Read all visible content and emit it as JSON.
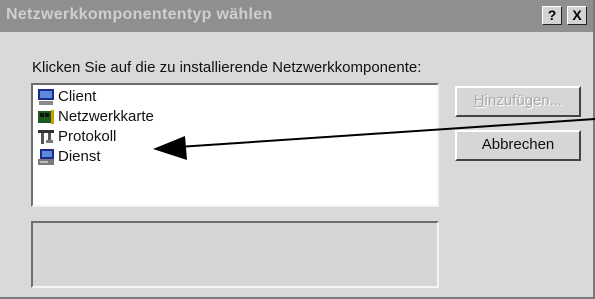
{
  "window": {
    "title": "Netzwerkkomponententyp wählen",
    "help_label": "?",
    "close_label": "X"
  },
  "prompt": "Klicken Sie auf die zu installierende Netzwerkkomponente:",
  "components": [
    {
      "label": "Client",
      "icon": "client-computer-icon"
    },
    {
      "label": "Netzwerkkarte",
      "icon": "network-card-icon"
    },
    {
      "label": "Protokoll",
      "icon": "protocol-icon"
    },
    {
      "label": "Dienst",
      "icon": "service-icon"
    }
  ],
  "buttons": {
    "add": {
      "accel": "H",
      "rest": "inzufügen...",
      "enabled": false
    },
    "cancel": "Abbrechen"
  },
  "colors": {
    "titlebar": "#8f8f8f",
    "dialog_bg": "#d9d9d9",
    "list_bg": "#ffffff",
    "arrow": "#000000"
  }
}
